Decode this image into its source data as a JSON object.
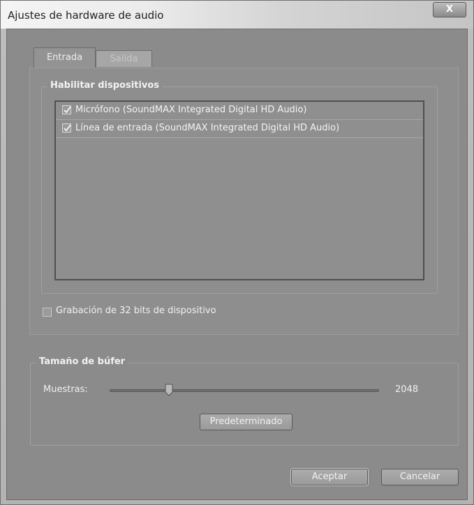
{
  "window": {
    "title": "Ajustes de hardware de audio",
    "close_glyph": "X"
  },
  "tabs": [
    {
      "label": "Entrada",
      "active": true
    },
    {
      "label": "Salida",
      "active": false
    }
  ],
  "devices_group": {
    "label": "Habilitar dispositivos",
    "items": [
      {
        "label": "Micrófono (SoundMAX Integrated Digital HD Audio)",
        "checked": true
      },
      {
        "label": "Línea de entrada (SoundMAX Integrated Digital HD Audio)",
        "checked": true
      }
    ]
  },
  "bit32": {
    "label": "Grabación de 32 bits de dispositivo",
    "checked": false
  },
  "buffer": {
    "label": "Tamaño de búfer",
    "samples_label": "Muestras:",
    "value": "2048",
    "slider_level": 0.21,
    "default_button": "Predeterminado"
  },
  "footer": {
    "ok": "Aceptar",
    "cancel": "Cancelar"
  },
  "icons": {
    "check": "checkmark-icon",
    "close": "close-icon",
    "slider": "slider-thumb-icon"
  }
}
